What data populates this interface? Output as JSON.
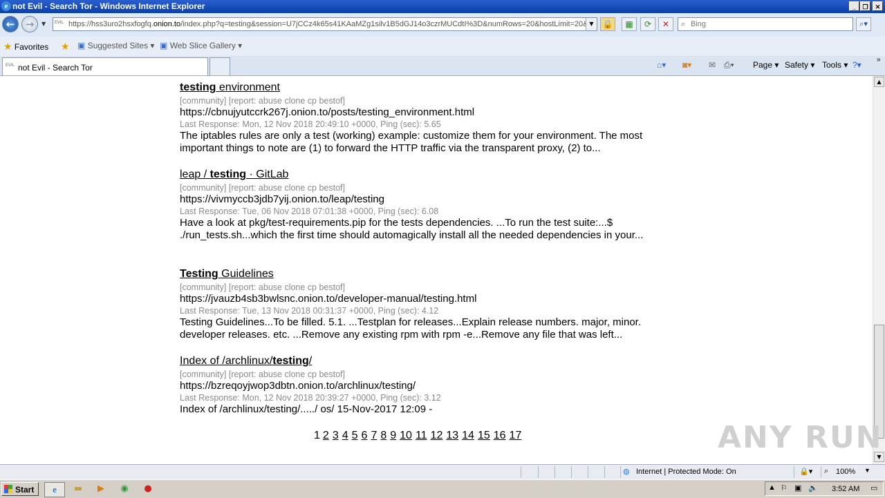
{
  "window": {
    "title": "not Evil - Search Tor - Windows Internet Explorer"
  },
  "address": {
    "favicon_text": "EVIL",
    "url_prefix": "https://hss3uro2hsxfogfq.",
    "url_domain": "onion.to",
    "url_rest": "/index.php?q=testing&session=U7jCCz4k65s41KAaMZg1silv1B5dGJ14o3czrMUCdtI%3D&numRows=20&hostLimit=20&te"
  },
  "search": {
    "placeholder": "Bing"
  },
  "favorites_bar": {
    "favorites_label": "Favorites",
    "suggested_sites": "Suggested Sites ▾",
    "web_slice_gallery": "Web Slice Gallery ▾"
  },
  "tab": {
    "favicon_text": "EVIL",
    "label": "not Evil - Search Tor"
  },
  "command_bar": {
    "page": "Page ▾",
    "safety": "Safety ▾",
    "tools": "Tools ▾"
  },
  "results": [
    {
      "title_bold": "testing",
      "title_pre": "",
      "title_post": " environment",
      "meta": "[community] [report: abuse clone cp bestof]",
      "url": "https://cbnujyutccrk267j.onion.to/posts/testing_environment.html",
      "last_response": "Last Response: Mon, 12 Nov 2018 20:49:10 +0000, Ping (sec): 5.65",
      "snippet": "The iptables rules are only a test (working) example: customize them for your environment. The most important things to note are (1) to forward the HTTP traffic via the transparent proxy, (2) to..."
    },
    {
      "title_pre": "leap / ",
      "title_bold": "testing",
      "title_post": " · GitLab",
      "meta": "[community] [report: abuse clone cp bestof]",
      "url": "https://vivmyccb3jdb7yij.onion.to/leap/testing",
      "last_response": "Last Response: Tue, 06 Nov 2018 07:01:38 +0000, Ping (sec): 6.08",
      "snippet": "Have a look at pkg/test-requirements.pip for the tests dependencies. ...To run the test suite:...$ ./run_tests.sh...which the first time should automagically install all the needed dependencies in your..."
    },
    {
      "title_pre": "",
      "title_bold": "Testing",
      "title_post": " Guidelines",
      "meta": "[community] [report: abuse clone cp bestof]",
      "url": "https://jvauzb4sb3bwlsnc.onion.to/developer-manual/testing.html",
      "last_response": "Last Response: Tue, 13 Nov 2018 00:31:37 +0000, Ping (sec): 4.12",
      "snippet": "Testing Guidelines...To be filled. 5.1. ...Testplan for releases...Explain release numbers. major, minor. developer releases. etc. ...Remove any existing rpm with rpm -e...Remove any file that was left..."
    },
    {
      "title_pre": "Index of /archlinux/",
      "title_bold": "testing",
      "title_post": "/",
      "meta": "[community] [report: abuse clone cp bestof]",
      "url": "https://bzreqoyjwop3dbtn.onion.to/archlinux/testing/",
      "last_response": "Last Response: Mon, 12 Nov 2018 20:39:27 +0000, Ping (sec): 3.12",
      "snippet": "Index of /archlinux/testing/...../ os/ 15-Nov-2017 12:09 -"
    }
  ],
  "pagination": {
    "current": "1",
    "pages": [
      "2",
      "3",
      "4",
      "5",
      "6",
      "7",
      "8",
      "9",
      "10",
      "11",
      "12",
      "13",
      "14",
      "15",
      "16",
      "17"
    ]
  },
  "watermark": "ANY RUN",
  "status": {
    "zone": "Internet | Protected Mode: On",
    "zoom": "100%"
  },
  "taskbar": {
    "start_label": "Start",
    "clock": "3:52 AM"
  },
  "colors": {
    "titlebar": "#0a3fa8",
    "link": "#000000",
    "meta_gray": "#8a8a8a"
  }
}
